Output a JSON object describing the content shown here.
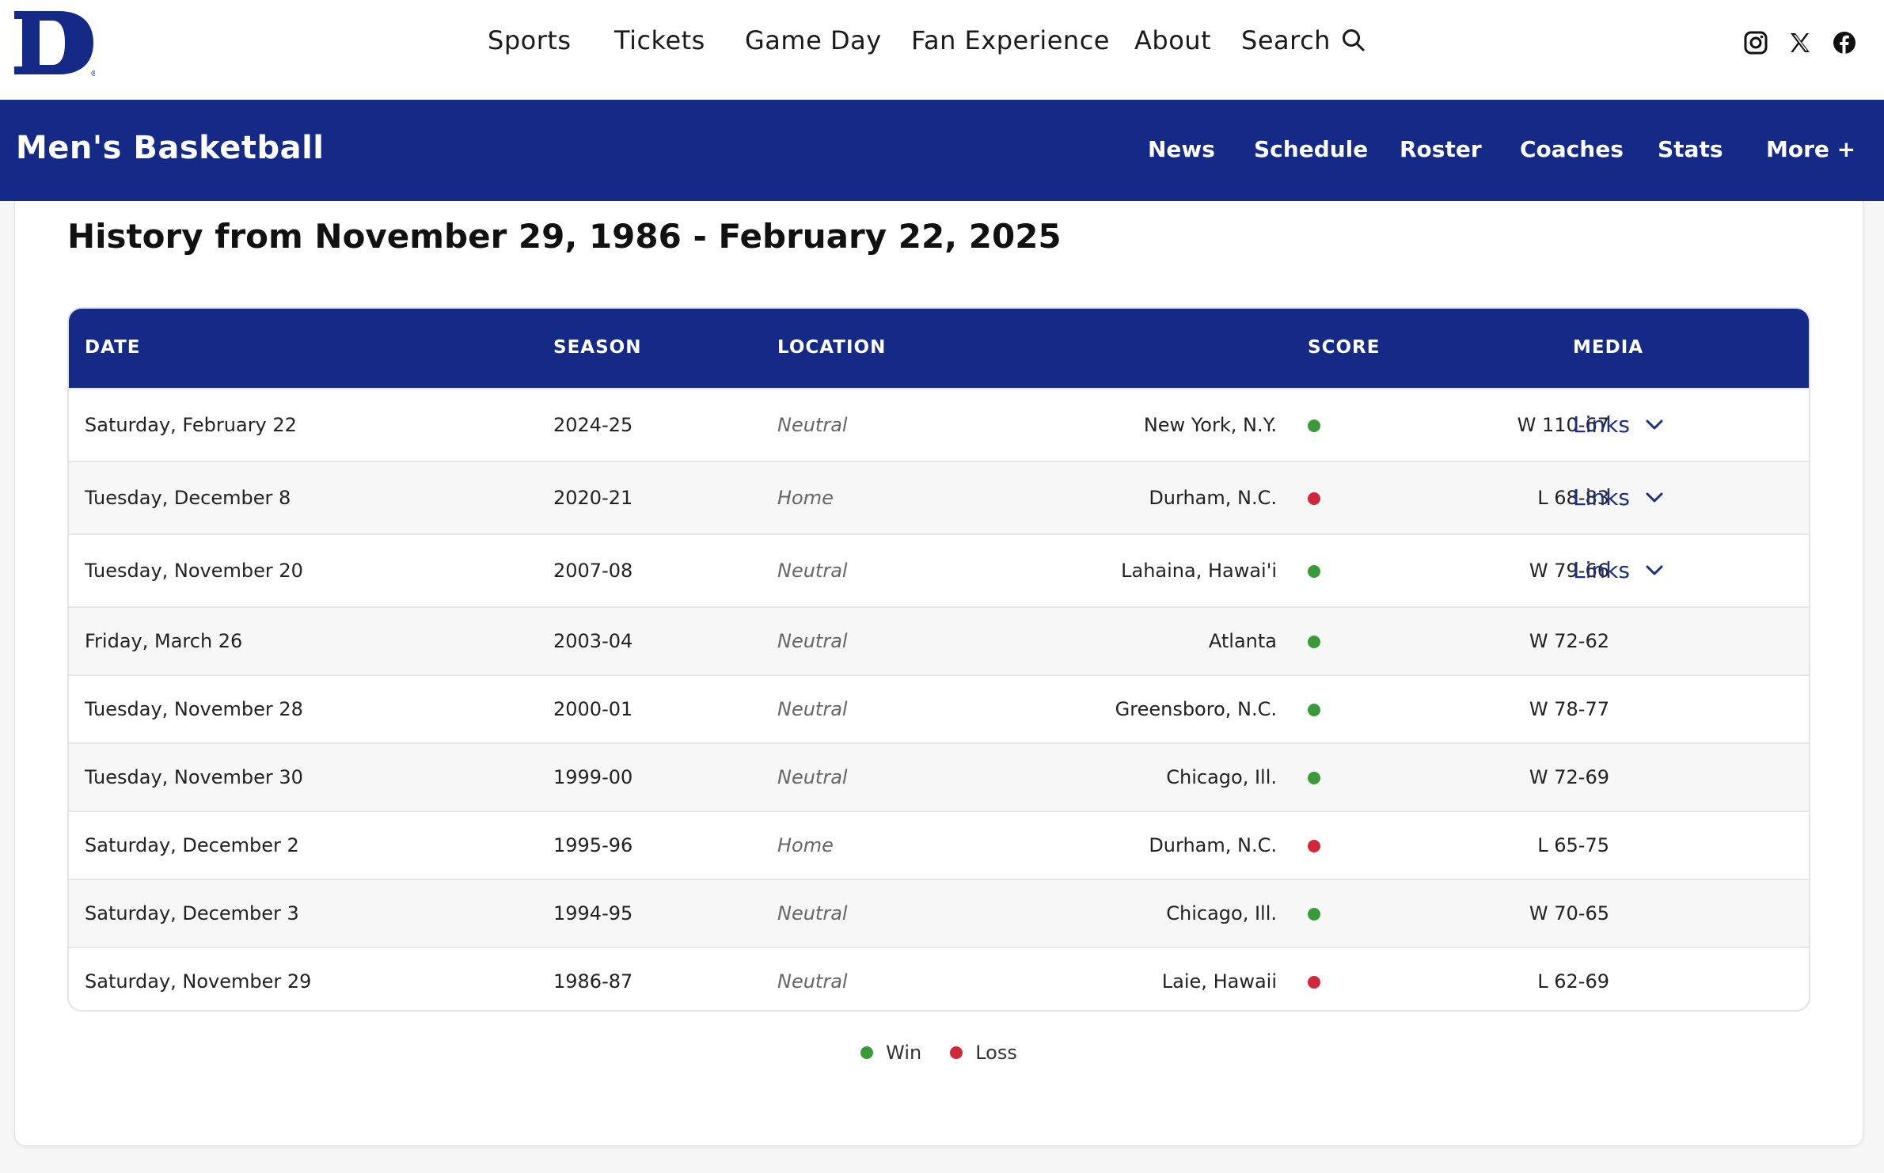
{
  "brand": {
    "logo_letter": "D",
    "registered_mark": "®",
    "primary_color": "#152a86"
  },
  "mainnav": {
    "items": [
      "Sports",
      "Tickets",
      "Game Day",
      "Fan Experience",
      "About"
    ],
    "search_label": "Search"
  },
  "social": [
    "instagram-icon",
    "x-icon",
    "facebook-icon"
  ],
  "subnav": {
    "title": "Men's Basketball",
    "items": [
      "News",
      "Schedule",
      "Roster",
      "Coaches",
      "Stats",
      "More +"
    ]
  },
  "history": {
    "title": "History from November 29, 1986 - February 22, 2025",
    "columns": [
      "DATE",
      "SEASON",
      "LOCATION",
      "SCORE",
      "MEDIA"
    ],
    "rows": [
      {
        "date": "Saturday, February 22",
        "season": "2024-25",
        "location": "Neutral",
        "city": "New York, N.Y.",
        "result": "win",
        "score": "W 110-67",
        "media": "Links"
      },
      {
        "date": "Tuesday, December 8",
        "season": "2020-21",
        "location": "Home",
        "city": "Durham, N.C.",
        "result": "loss",
        "score": "L 68-83",
        "media": "Links"
      },
      {
        "date": "Tuesday, November 20",
        "season": "2007-08",
        "location": "Neutral",
        "city": "Lahaina, Hawai'i",
        "result": "win",
        "score": "W 79-66",
        "media": "Links"
      },
      {
        "date": "Friday, March 26",
        "season": "2003-04",
        "location": "Neutral",
        "city": "Atlanta",
        "result": "win",
        "score": "W 72-62",
        "media": ""
      },
      {
        "date": "Tuesday, November 28",
        "season": "2000-01",
        "location": "Neutral",
        "city": "Greensboro, N.C.",
        "result": "win",
        "score": "W 78-77",
        "media": ""
      },
      {
        "date": "Tuesday, November 30",
        "season": "1999-00",
        "location": "Neutral",
        "city": "Chicago, Ill.",
        "result": "win",
        "score": "W 72-69",
        "media": ""
      },
      {
        "date": "Saturday, December 2",
        "season": "1995-96",
        "location": "Home",
        "city": "Durham, N.C.",
        "result": "loss",
        "score": "L 65-75",
        "media": ""
      },
      {
        "date": "Saturday, December 3",
        "season": "1994-95",
        "location": "Neutral",
        "city": "Chicago, Ill.",
        "result": "win",
        "score": "W 70-65",
        "media": ""
      },
      {
        "date": "Saturday, November 29",
        "season": "1986-87",
        "location": "Neutral",
        "city": "Laie, Hawaii",
        "result": "loss",
        "score": "L 62-69",
        "media": ""
      }
    ]
  },
  "legend": {
    "win_label": "Win",
    "loss_label": "Loss",
    "win_color": "#3a9a3a",
    "loss_color": "#d0283a"
  }
}
